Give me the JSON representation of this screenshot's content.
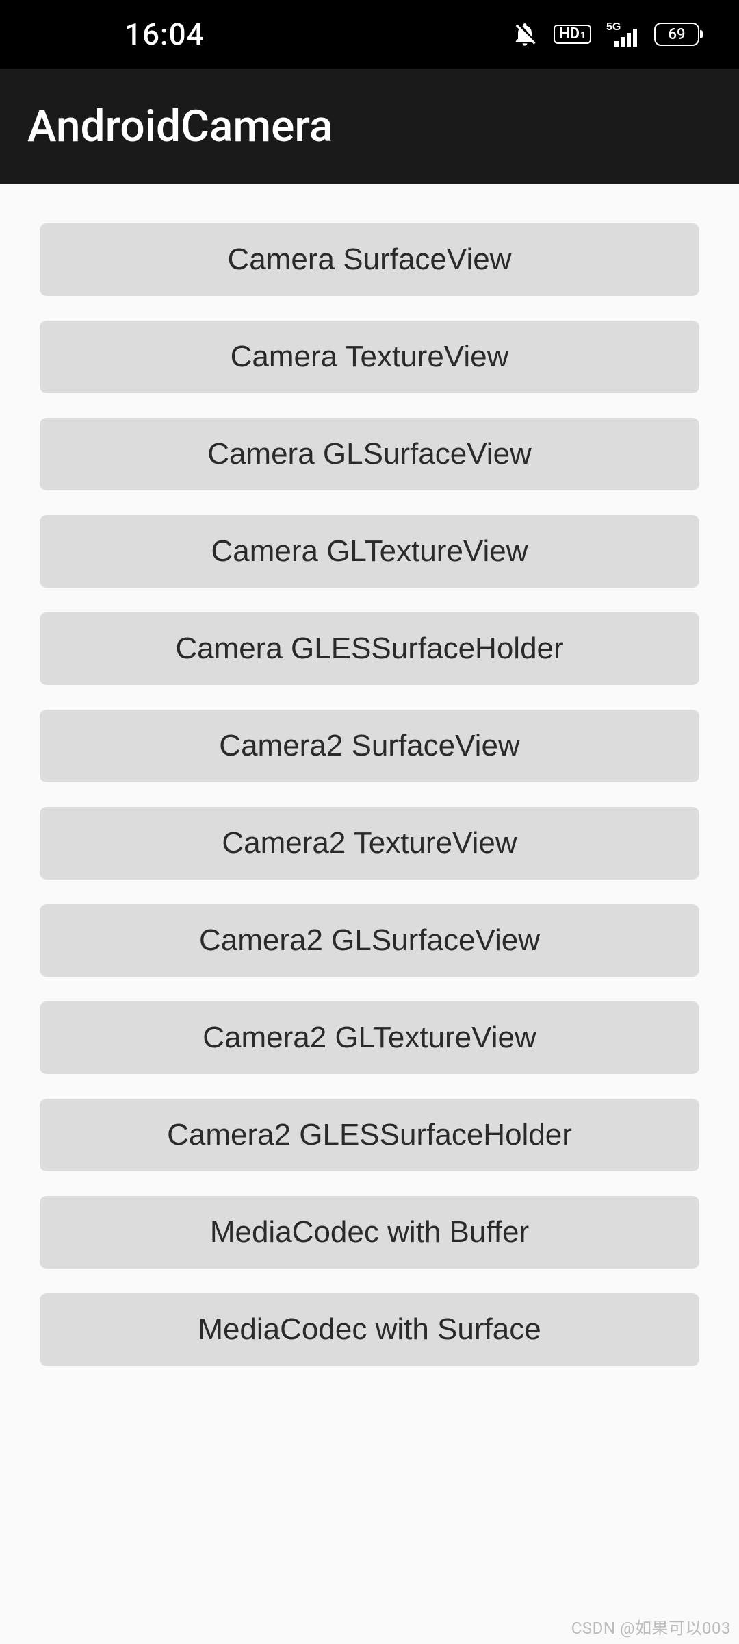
{
  "status": {
    "time": "16:04",
    "hd_label": "HD",
    "hd_sub": "1",
    "network_label": "5G",
    "battery": "69"
  },
  "header": {
    "title": "AndroidCamera"
  },
  "buttons": [
    "Camera SurfaceView",
    "Camera TextureView",
    "Camera GLSurfaceView",
    "Camera GLTextureView",
    "Camera GLESSurfaceHolder",
    "Camera2 SurfaceView",
    "Camera2 TextureView",
    "Camera2 GLSurfaceView",
    "Camera2 GLTextureView",
    "Camera2 GLESSurfaceHolder",
    "MediaCodec with Buffer",
    "MediaCodec with Surface"
  ],
  "watermark": "CSDN @如果可以003"
}
